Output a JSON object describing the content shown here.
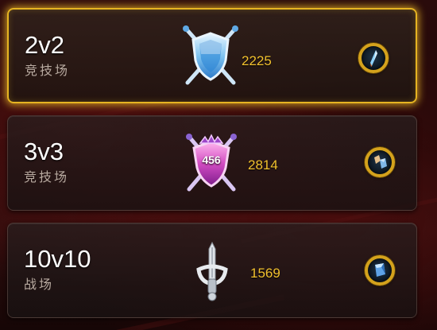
{
  "modes": [
    {
      "title": "2v2",
      "subtitle": "竞技场",
      "rating": "2225",
      "badge_icon": "blue-crossed-swords-shield-icon",
      "reward_icon": "blue-crystal-shard-icon",
      "selected": true
    },
    {
      "title": "3v3",
      "subtitle": "竞技场",
      "rating": "2814",
      "badge_icon": "purple-crossed-swords-shield-icon",
      "badge_text": "456",
      "reward_icon": "twin-gem-icon",
      "selected": false
    },
    {
      "title": "10v10",
      "subtitle": "战场",
      "rating": "1569",
      "badge_icon": "silver-sword-icon",
      "reward_icon": "blue-cube-gem-icon",
      "selected": false
    }
  ],
  "colors": {
    "highlight_border": "#e6b422",
    "rating_text": "#f2c12e",
    "reward_ring": "#d4a21c"
  }
}
